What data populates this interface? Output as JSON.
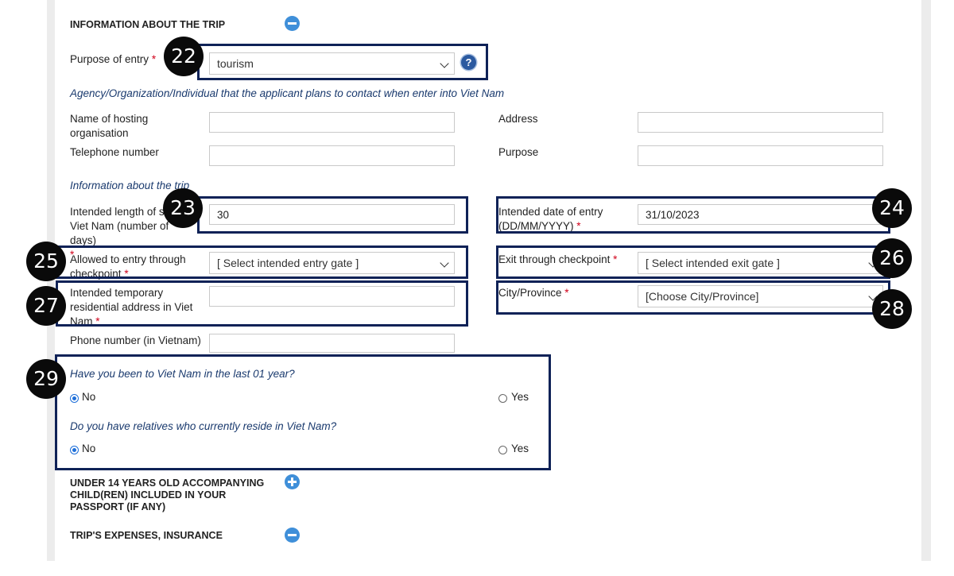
{
  "sections": {
    "trip_info": "INFORMATION ABOUT THE TRIP",
    "children": "UNDER 14 YEARS OLD ACCOMPANYING CHILD(REN) INCLUDED IN YOUR PASSPORT (IF ANY)",
    "expenses": "TRIP'S EXPENSES, INSURANCE"
  },
  "purpose": {
    "label": "Purpose of entry",
    "value": "tourism",
    "help": "?"
  },
  "agency": {
    "heading": "Agency/Organization/Individual that the applicant plans to contact when enter into Viet Nam",
    "hosting_label": "Name of hosting organisation",
    "hosting_value": "",
    "address_label": "Address",
    "address_value": "",
    "telephone_label": "Telephone number",
    "telephone_value": "",
    "purpose_label": "Purpose",
    "purpose_value": ""
  },
  "trip": {
    "heading": "Information about the trip",
    "length_label": "Intended length of stay in Viet Nam (number of days)",
    "length_value": "30",
    "entry_date_label": "Intended date of entry (DD/MM/YYYY)",
    "entry_date_value": "31/10/2023",
    "entry_gate_label": "Allowed to entry through checkpoint",
    "entry_gate_value": "[ Select intended entry gate ]",
    "exit_gate_label": "Exit through checkpoint",
    "exit_gate_value": "[ Select intended exit gate ]",
    "address_label": "Intended temporary residential address in Viet Nam",
    "address_value": "",
    "city_label": "City/Province",
    "city_value": "[Choose City/Province]",
    "phone_label": "Phone number (in Vietnam)",
    "phone_value": ""
  },
  "questions": {
    "q1": "Have you been to Viet Nam in the last 01 year?",
    "q2": "Do you have relatives who currently reside in Viet Nam?",
    "no": "No",
    "yes": "Yes",
    "q1_selected": "No",
    "q2_selected": "No"
  },
  "required_mark": "*",
  "badges": [
    "22",
    "23",
    "24",
    "25",
    "26",
    "27",
    "28",
    "29"
  ],
  "colors": {
    "highlight": "#0f2257",
    "accent": "#3f8fd9",
    "required": "#d0021b",
    "subheading": "#1a3a6e"
  },
  "icons": {
    "collapse": "minus-circle-icon",
    "expand": "plus-circle-icon",
    "help": "question-circle-icon"
  }
}
